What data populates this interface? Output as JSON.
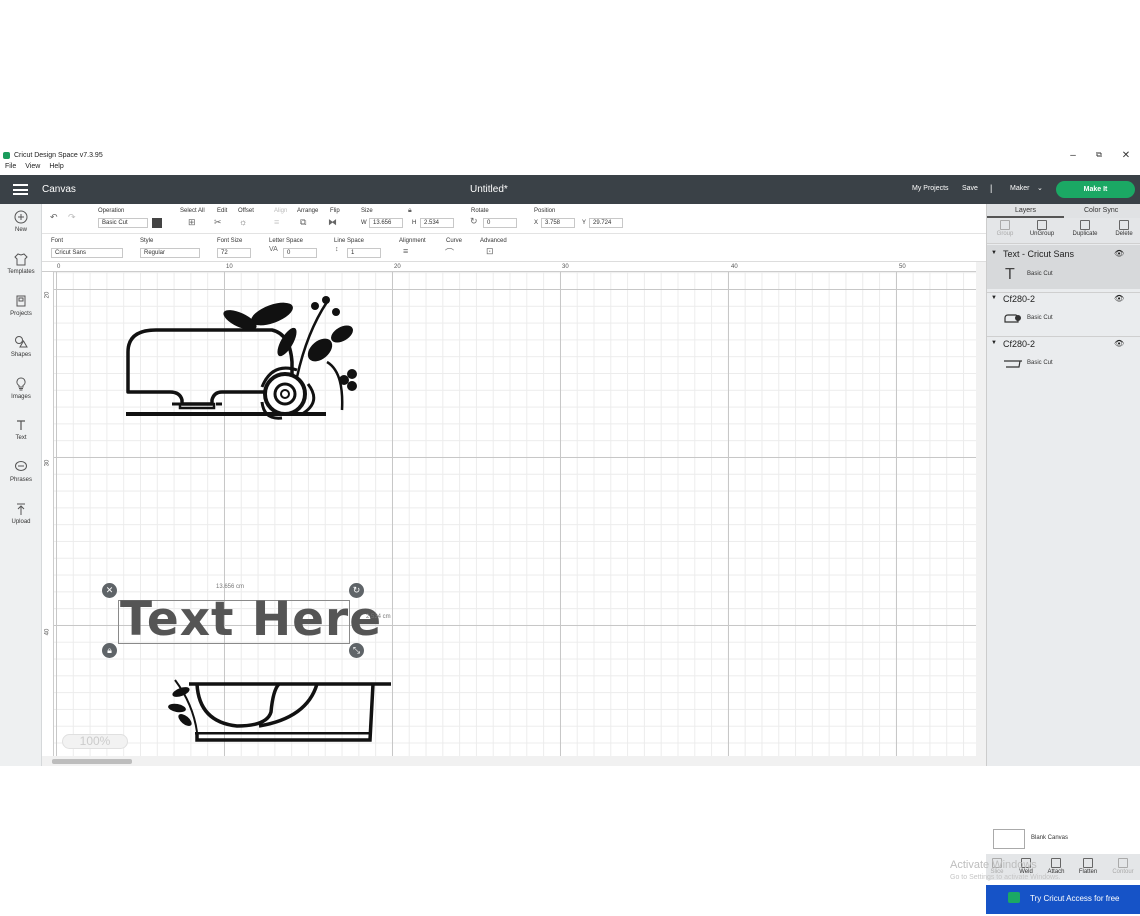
{
  "window": {
    "app_title": "Cricut Design Space  v7.3.95",
    "min": "–",
    "restore": "⧉",
    "close": "✕"
  },
  "menu": [
    "File",
    "View",
    "Help"
  ],
  "header": {
    "section": "Canvas",
    "title": "Untitled*",
    "my_projects": "My Projects",
    "save": "Save",
    "separator": "|",
    "machine": "Maker",
    "make_it": "Make It"
  },
  "sidebar": [
    {
      "label": "New",
      "icon": "plus-circle-icon"
    },
    {
      "label": "Templates",
      "icon": "shirt-icon"
    },
    {
      "label": "Projects",
      "icon": "projects-icon"
    },
    {
      "label": "Shapes",
      "icon": "shapes-icon"
    },
    {
      "label": "Images",
      "icon": "lightbulb-icon"
    },
    {
      "label": "Text",
      "icon": "text-icon"
    },
    {
      "label": "Phrases",
      "icon": "phrases-icon"
    },
    {
      "label": "Upload",
      "icon": "upload-icon"
    }
  ],
  "toolbar1": {
    "operation_label": "Operation",
    "operation_value": "Basic Cut",
    "select_all": "Select All",
    "edit": "Edit",
    "offset": "Offset",
    "align": "Align",
    "arrange": "Arrange",
    "flip": "Flip",
    "size": "Size",
    "w_label": "W",
    "w_value": "13.656",
    "h_label": "H",
    "h_value": "2.534",
    "rotate": "Rotate",
    "rotate_value": "0",
    "position": "Position",
    "x_label": "X",
    "x_value": "3.758",
    "y_label": "Y",
    "y_value": "29.724"
  },
  "toolbar2": {
    "font_label": "Font",
    "font_value": "Cricut Sans",
    "style_label": "Style",
    "style_value": "Regular",
    "font_size_label": "Font Size",
    "font_size_value": "72",
    "letter_space_label": "Letter Space",
    "letter_space_value": "0",
    "line_space_label": "Line Space",
    "line_space_value": "1",
    "alignment_label": "Alignment",
    "curve_label": "Curve",
    "advanced_label": "Advanced"
  },
  "rulers": {
    "top": [
      "0",
      "10",
      "20",
      "30",
      "40",
      "50"
    ],
    "left": [
      "20",
      "30",
      "40"
    ]
  },
  "canvas": {
    "text_object": "Text Here",
    "width_readout": "13.656 cm",
    "height_readout": "2.534 cm",
    "zoom": "100%"
  },
  "panel": {
    "tab_layers": "Layers",
    "tab_color_sync": "Color Sync",
    "tools": [
      "Group",
      "UnGroup",
      "Duplicate",
      "Delete"
    ],
    "layers": [
      {
        "name": "Text - Cricut Sans",
        "operation": "Basic Cut"
      },
      {
        "name": "Cf280-2",
        "operation": "Basic Cut"
      },
      {
        "name": "Cf280-2",
        "operation": "Basic Cut"
      }
    ],
    "blank_canvas": "Blank Canvas",
    "bottom_tools": [
      "Slice",
      "Weld",
      "Attach",
      "Flatten",
      "Contour"
    ],
    "try_access": "Try Cricut Access for free"
  },
  "watermark": {
    "line1": "Activate Windows",
    "line2": "Go to Settings to activate Windows."
  },
  "colors": {
    "header": "#3a4147",
    "make_it": "#1ba864",
    "access_banner": "#1653c7"
  }
}
